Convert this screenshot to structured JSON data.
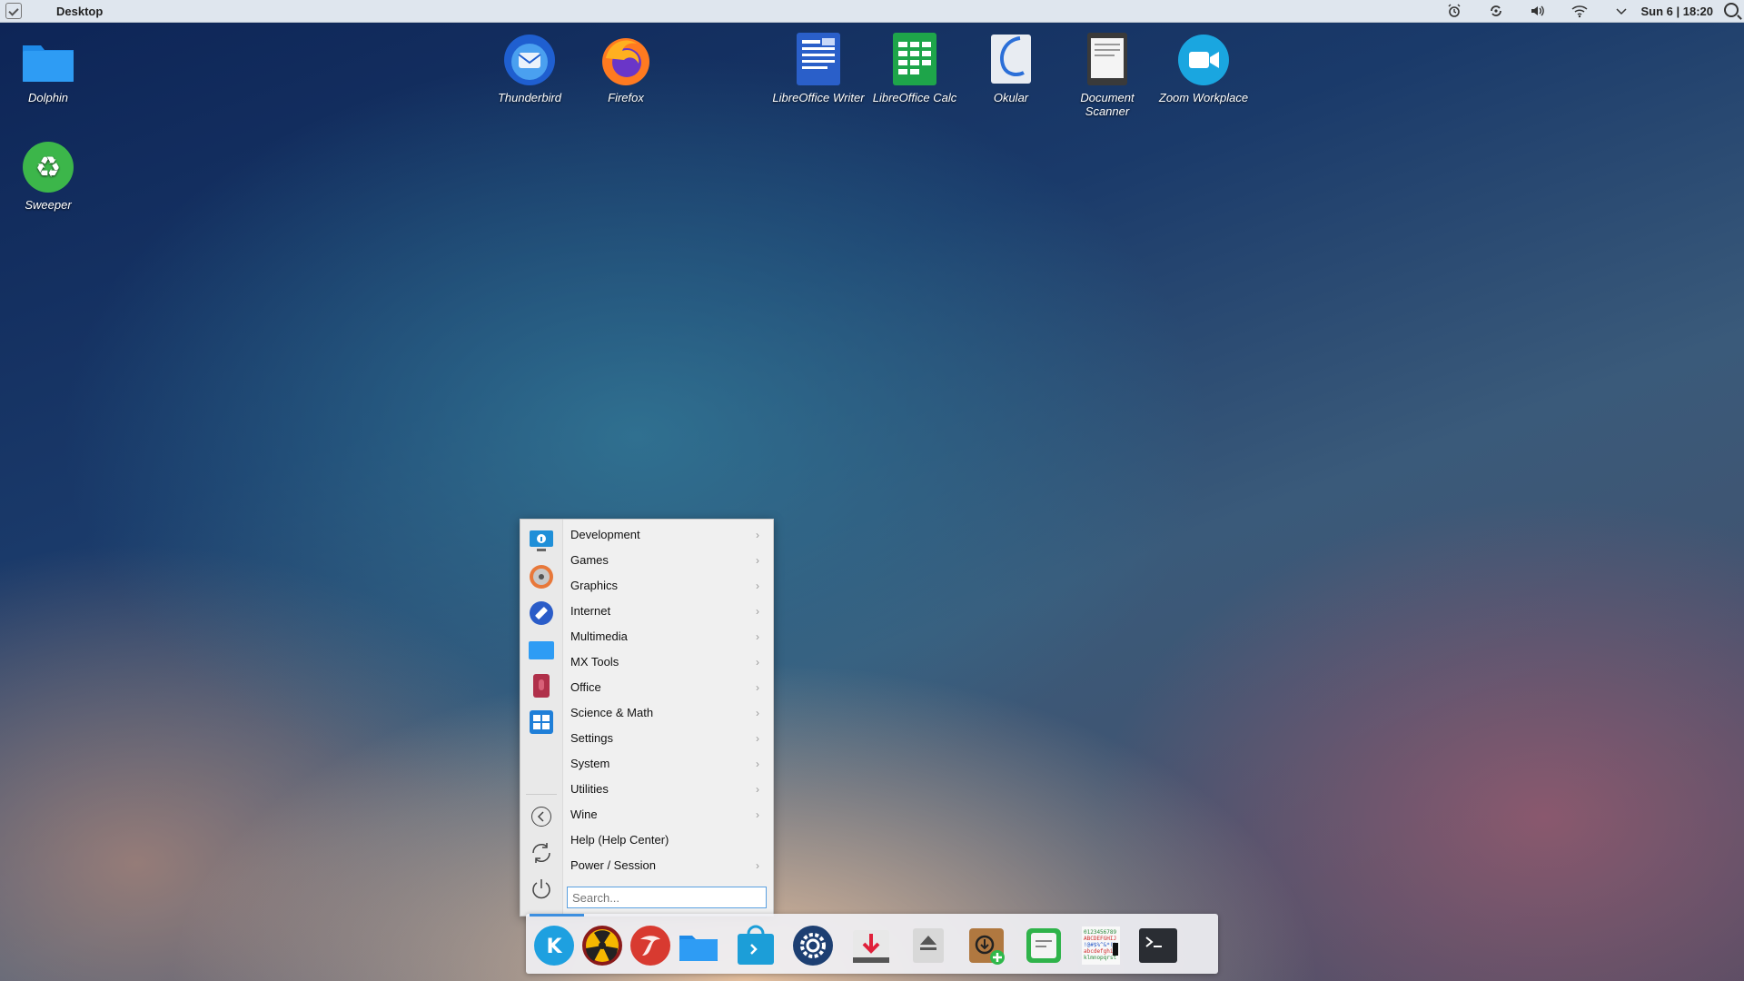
{
  "topbar": {
    "title": "Desktop",
    "clock": "Sun 6 | 18:20",
    "tray_icons": [
      "alarm-icon",
      "sync-icon",
      "volume-icon",
      "wifi-icon",
      "chevron-down-icon"
    ]
  },
  "desktop_icons": [
    {
      "label": "Dolphin",
      "icon": "folder-icon"
    },
    {
      "label": "Sweeper",
      "icon": "recycle-icon"
    },
    {
      "label": "Thunderbird",
      "icon": "thunderbird-icon"
    },
    {
      "label": "Firefox",
      "icon": "firefox-icon"
    },
    {
      "label": "LibreOffice Writer",
      "icon": "writer-icon"
    },
    {
      "label": "LibreOffice Calc",
      "icon": "calc-icon"
    },
    {
      "label": "Okular",
      "icon": "okular-icon"
    },
    {
      "label": "Document Scanner",
      "icon": "scanner-icon"
    },
    {
      "label": "Zoom Workplace",
      "icon": "zoom-icon"
    }
  ],
  "menu": {
    "items": [
      {
        "label": "Development",
        "submenu": true
      },
      {
        "label": "Games",
        "submenu": true
      },
      {
        "label": "Graphics",
        "submenu": true
      },
      {
        "label": "Internet",
        "submenu": true
      },
      {
        "label": "Multimedia",
        "submenu": true
      },
      {
        "label": "MX Tools",
        "submenu": true
      },
      {
        "label": "Office",
        "submenu": true
      },
      {
        "label": "Science & Math",
        "submenu": true
      },
      {
        "label": "Settings",
        "submenu": true
      },
      {
        "label": "System",
        "submenu": true
      },
      {
        "label": "Utilities",
        "submenu": true
      },
      {
        "label": "Wine",
        "submenu": true
      },
      {
        "label": "Help (Help Center)",
        "submenu": false
      },
      {
        "label": "Power / Session",
        "submenu": true
      }
    ],
    "chevron": "›",
    "search_placeholder": "Search..."
  },
  "dock": {
    "apps": [
      "kde-menu-icon",
      "radiation-icon",
      "taskbar-app-icon",
      "folder-icon",
      "software-center-icon",
      "settings-gear-icon",
      "downloader-icon",
      "eject-icon",
      "package-installer-icon",
      "notes-icon",
      "font-viewer-icon",
      "terminal-icon"
    ]
  }
}
